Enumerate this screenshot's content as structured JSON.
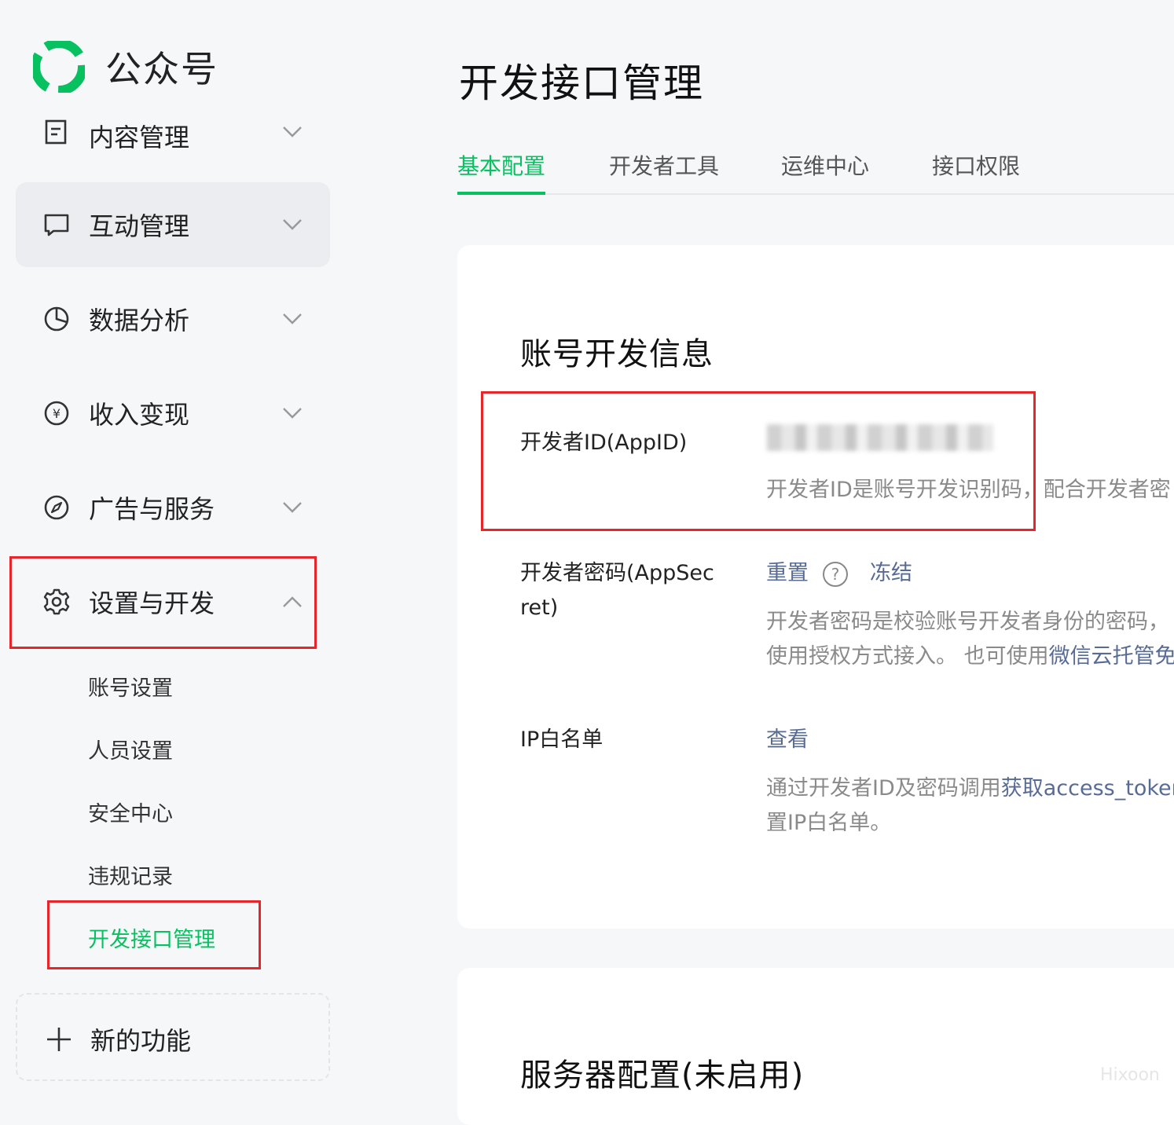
{
  "brand": {
    "name": "公众号",
    "color": "#07c160"
  },
  "sidebar": {
    "items": [
      {
        "label": "内容管理",
        "icon": "document-icon"
      },
      {
        "label": "互动管理",
        "icon": "chat-bubble-icon"
      },
      {
        "label": "数据分析",
        "icon": "pie-chart-icon"
      },
      {
        "label": "收入变现",
        "icon": "yen-circle-icon"
      },
      {
        "label": "广告与服务",
        "icon": "compass-icon"
      },
      {
        "label": "设置与开发",
        "icon": "gear-icon"
      }
    ],
    "sub_items": [
      "账号设置",
      "人员设置",
      "安全中心",
      "违规记录",
      "开发接口管理"
    ],
    "new_func_label": "新的功能"
  },
  "main": {
    "title": "开发接口管理",
    "tabs": [
      "基本配置",
      "开发者工具",
      "运维中心",
      "接口权限"
    ],
    "account_section": {
      "title": "账号开发信息",
      "appid_label": "开发者ID(AppID)",
      "appid_desc": "开发者ID是账号开发识别码，配合开发者密",
      "secret_label_1": "开发者密码(AppSec",
      "secret_label_2": "ret)",
      "reset_link": "重置",
      "freeze_link": "冻结",
      "secret_desc_1": "开发者密码是校验账号开发者身份的密码，",
      "secret_desc_2a": "使用授权方式接入。 也可使用",
      "secret_desc_2b": "微信云托管免",
      "ip_label": "IP白名单",
      "ip_view_link": "查看",
      "ip_desc_1a": "通过开发者ID及密码调用",
      "ip_desc_1b": "获取access_token",
      "ip_desc_2": "置IP白名单。"
    },
    "server_section": {
      "title": "服务器配置(未启用)"
    }
  },
  "watermark": "Hixoon"
}
